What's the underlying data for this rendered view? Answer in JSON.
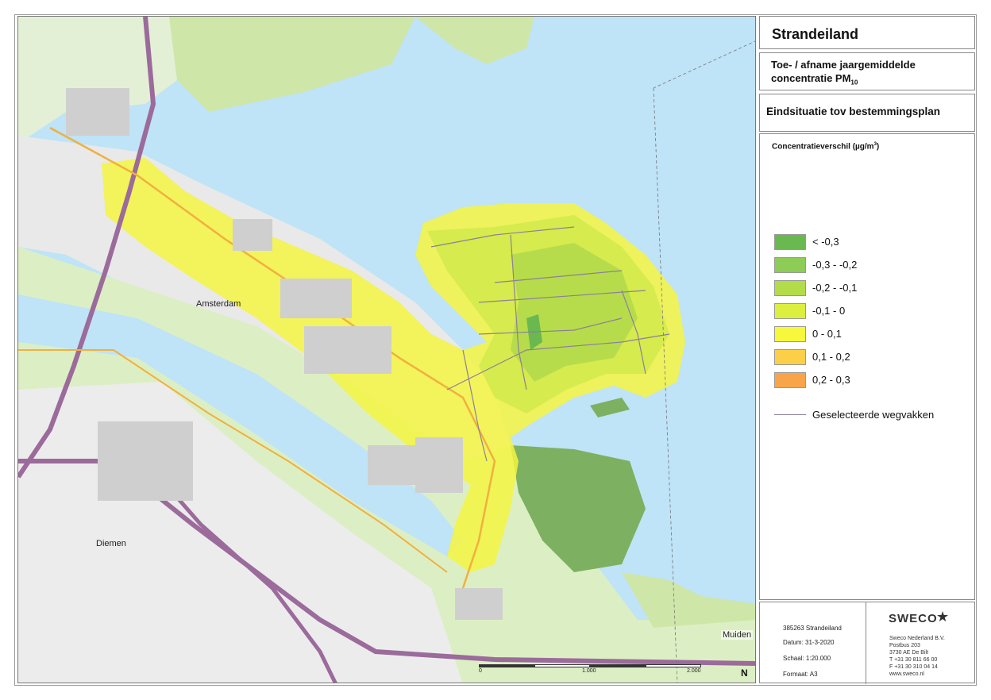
{
  "title": "Strandeiland",
  "subtitle": {
    "line1": "Toe- / afname jaargemiddelde",
    "line2_main": "concentratie PM",
    "line2_sub": "10"
  },
  "situation": "Eindsituatie tov bestemmingsplan",
  "legend": {
    "title_main": "Concentratieverschil (µg/m",
    "title_sup": "3",
    "title_end": ")",
    "items": [
      {
        "label": "< -0,3",
        "color": "#6ab850"
      },
      {
        "label": "-0,3 - -0,2",
        "color": "#8dcc57"
      },
      {
        "label": "-0,2 - -0,1",
        "color": "#b2dc4a"
      },
      {
        "label": "-0,1 - 0",
        "color": "#dcef3f"
      },
      {
        "label": "0 - 0,1",
        "color": "#f7f73c"
      },
      {
        "label": "0,1 - 0,2",
        "color": "#fbcf48"
      },
      {
        "label": "0,2 - 0,3",
        "color": "#f8a54a"
      }
    ],
    "line_item": {
      "label": "Geselecteerde wegvakken",
      "color": "#8d7f99"
    }
  },
  "map_labels": {
    "amsterdam": "Amsterdam",
    "diemen": "Diemen",
    "muiden": "Muiden",
    "north": "N"
  },
  "scale_labels": [
    "0",
    "1.000",
    "2.000"
  ],
  "project_info": {
    "project": "385263 Strandeiland",
    "date": "Datum: 31-3-2020",
    "scale": "Schaal: 1:20.000",
    "format": "Formaat: A3"
  },
  "company": {
    "logo": "SWECO",
    "icon": "sweco-figure-icon",
    "address": [
      "Sweco Nederland B.V.",
      "Postbus 203",
      "3730 AE  De Bilt",
      "T +31 30 811 66 00",
      "F +31 30 310 04 14",
      "www.sweco.nl"
    ]
  },
  "colors": {
    "water": "#bfe3f7",
    "land": "#dff0c5",
    "urban": "#f3f3f3",
    "road_main": "#9b6b9b",
    "road_secondary": "#f0b040",
    "nature": "#5c9b48"
  }
}
